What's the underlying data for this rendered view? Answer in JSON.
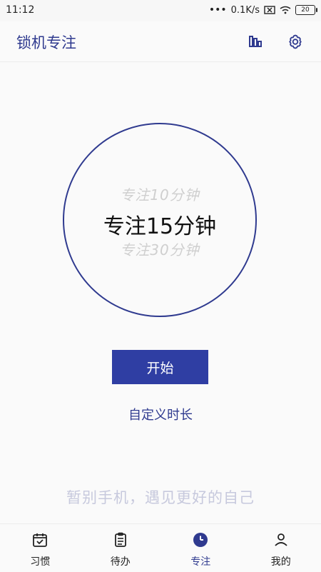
{
  "status_bar": {
    "time": "11:12",
    "dots": "•••",
    "network_speed": "0.1K/s",
    "battery": "20"
  },
  "header": {
    "title": "锁机专注",
    "stats_icon": "bar-chart-icon",
    "settings_icon": "gear-icon"
  },
  "timer_picker": {
    "previous_option": "专注10分钟",
    "current_option": "专注15分钟",
    "next_option": "专注30分钟"
  },
  "actions": {
    "start_label": "开始",
    "custom_duration_label": "自定义时长"
  },
  "slogan": "暂别手机，遇见更好的自己",
  "bottom_nav": {
    "items": [
      {
        "label": "习惯",
        "icon": "calendar-check-icon"
      },
      {
        "label": "待办",
        "icon": "clipboard-icon"
      },
      {
        "label": "专注",
        "icon": "clock-icon"
      },
      {
        "label": "我的",
        "icon": "user-icon"
      }
    ]
  },
  "colors": {
    "accent": "#2f3a8f",
    "button": "#2f3ea3",
    "muted_text": "#c7c9dd"
  }
}
